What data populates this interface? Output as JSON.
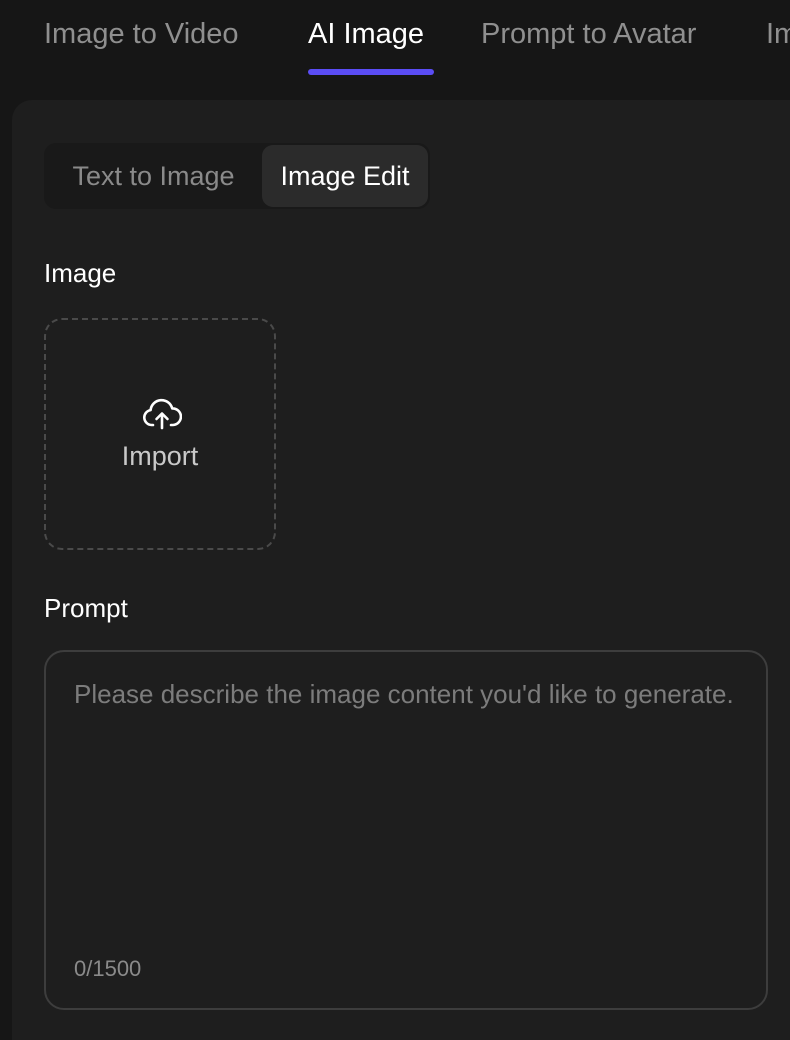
{
  "top_tabs": [
    {
      "label": "Image to Video"
    },
    {
      "label": "AI Image",
      "active": true
    },
    {
      "label": "Prompt to Avatar"
    },
    {
      "label": "Im"
    }
  ],
  "segmented": {
    "options": [
      {
        "label": "Text to Image"
      },
      {
        "label": "Image Edit",
        "active": true
      }
    ]
  },
  "image_section": {
    "label": "Image",
    "import_label": "Import",
    "icon": "cloud-upload-icon"
  },
  "prompt_section": {
    "label": "Prompt",
    "placeholder": "Please describe the image content you'd like to generate.",
    "value": "",
    "char_count": "0/1500"
  },
  "colors": {
    "accent": "#5b4df5",
    "background": "#161616",
    "panel": "#1e1e1e"
  }
}
